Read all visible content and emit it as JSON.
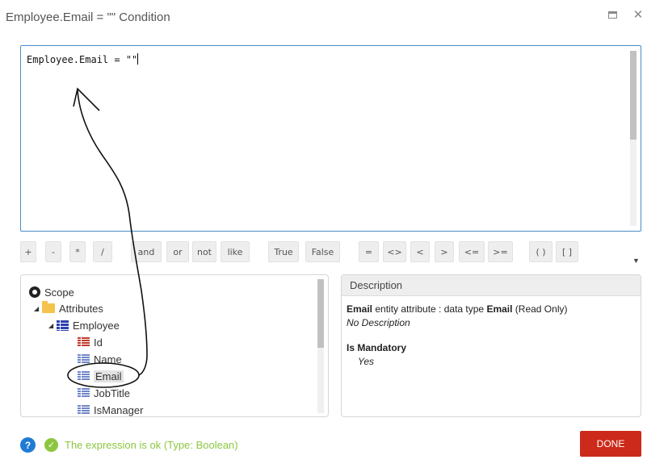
{
  "window": {
    "title": "Employee.Email = \"\" Condition",
    "maximize_icon": "maximize-icon",
    "close_icon": "close-icon",
    "close_glyph": "✕"
  },
  "editor": {
    "expression": "Employee.Email = \"\""
  },
  "operators": [
    {
      "name": "op-plus",
      "label": "+"
    },
    {
      "name": "op-minus",
      "label": "-"
    },
    {
      "name": "op-multiply",
      "label": "*"
    },
    {
      "name": "op-divide",
      "label": "/"
    },
    {
      "name": "op-and",
      "label": "and"
    },
    {
      "name": "op-or",
      "label": "or"
    },
    {
      "name": "op-not",
      "label": "not"
    },
    {
      "name": "op-like",
      "label": "like"
    },
    {
      "name": "op-true",
      "label": "True"
    },
    {
      "name": "op-false",
      "label": "False"
    },
    {
      "name": "op-equal",
      "label": "="
    },
    {
      "name": "op-not-equal",
      "label": "<>"
    },
    {
      "name": "op-less",
      "label": "<"
    },
    {
      "name": "op-greater",
      "label": ">"
    },
    {
      "name": "op-less-equal",
      "label": "<="
    },
    {
      "name": "op-greater-equal",
      "label": ">="
    },
    {
      "name": "op-parentheses",
      "label": "( )"
    },
    {
      "name": "op-brackets",
      "label": "[ ]"
    }
  ],
  "tree": {
    "scope": "Scope",
    "attributes": "Attributes",
    "entity": "Employee",
    "fields": [
      "Id",
      "Name",
      "Email",
      "JobTitle",
      "IsManager"
    ],
    "selected": "Email"
  },
  "description": {
    "header": "Description",
    "name": "Email",
    "text_mid": " entity attribute : data type ",
    "type": "Email",
    "text_end": " (Read Only)",
    "no_desc": "No Description",
    "mandatory_title": "Is Mandatory",
    "mandatory_value": "Yes"
  },
  "footer": {
    "help_glyph": "?",
    "ok_glyph": "✓",
    "status": "The expression is ok (Type: Boolean)",
    "done_label": "DONE"
  },
  "colors": {
    "accent_blue": "#4a8cc9",
    "ok_green": "#8cc63f",
    "done_red": "#cc2a1a"
  }
}
